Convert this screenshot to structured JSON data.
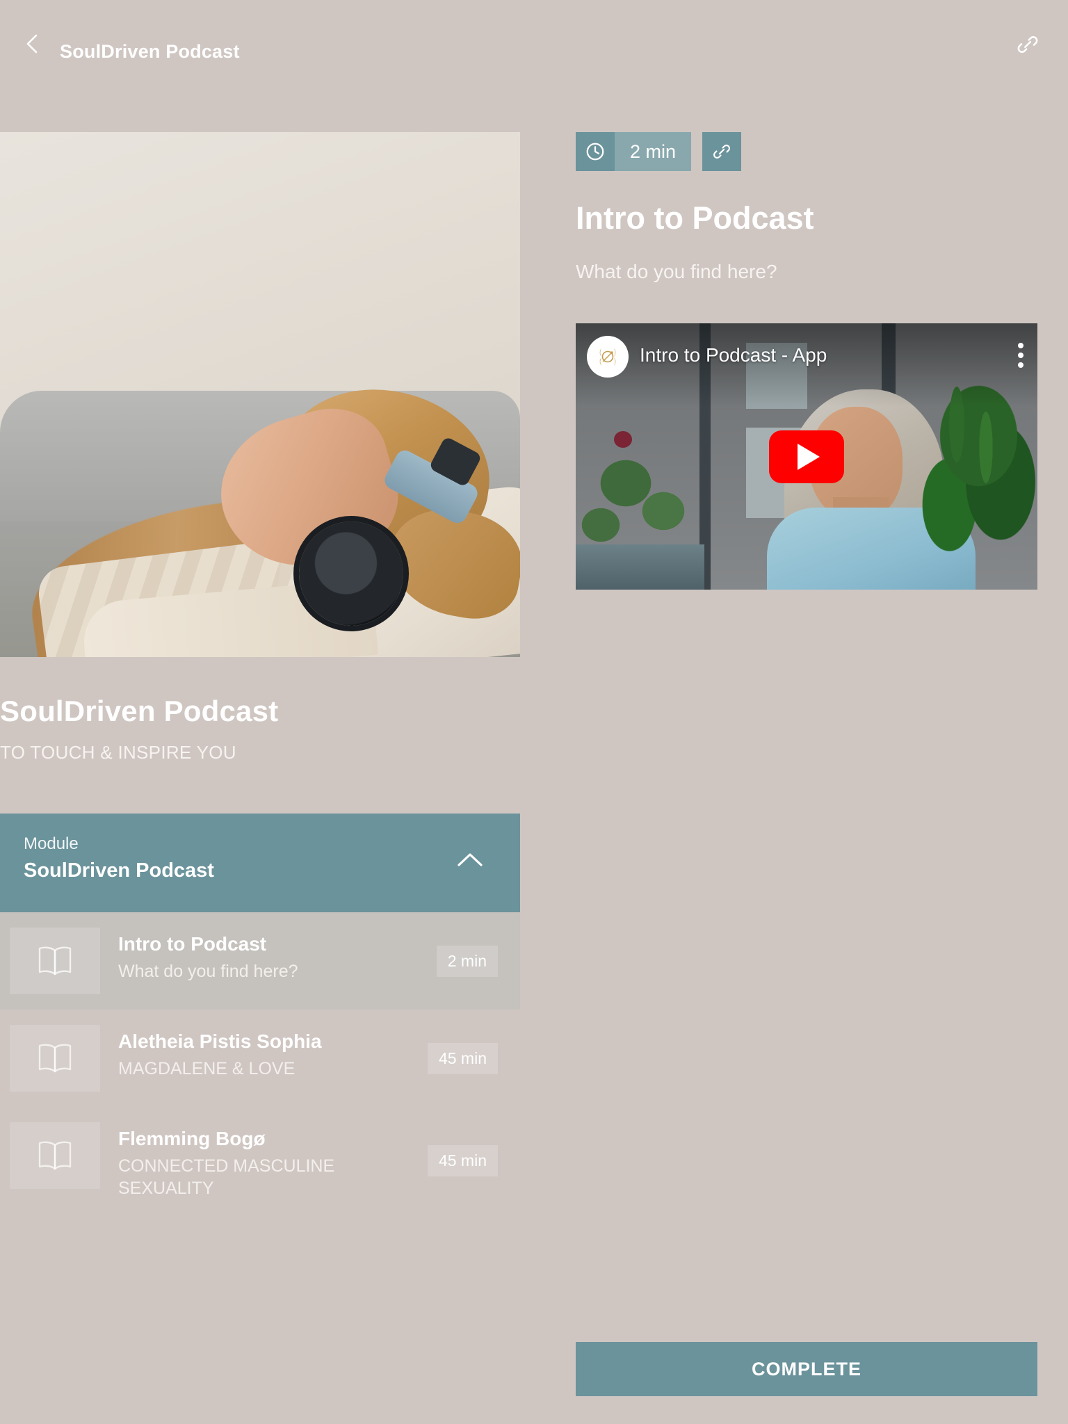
{
  "topbar": {
    "back_icon": "chevron-left-icon",
    "title": "SoulDriven Podcast",
    "share_icon": "link-icon"
  },
  "course": {
    "hero_image_alt": "woman-relaxing-with-headphones",
    "title": "SoulDriven Podcast",
    "subtitle": "TO TOUCH & INSPIRE YOU"
  },
  "module": {
    "kicker": "Module",
    "title": "SoulDriven Podcast",
    "collapse_icon": "chevron-up-icon"
  },
  "lessons": [
    {
      "icon": "open-book-icon",
      "title": "Intro to Podcast",
      "subtitle": "What do you find here?",
      "duration": "2 min",
      "active": true
    },
    {
      "icon": "open-book-icon",
      "title": "Aletheia Pistis Sophia",
      "subtitle": "MAGDALENE & LOVE",
      "duration": "45 min",
      "active": false
    },
    {
      "icon": "open-book-icon",
      "title": "Flemming Bogø",
      "subtitle": "CONNECTED MASCULINE SEXUALITY",
      "duration": "45 min",
      "active": false
    }
  ],
  "lesson_detail": {
    "clock_icon": "clock-icon",
    "duration": "2 min",
    "link_icon": "link-icon",
    "title": "Intro to Podcast",
    "subtitle": "What do you find here?",
    "video": {
      "channel_avatar": "triple-moon-logo-icon",
      "title": "Intro to Podcast - App",
      "menu_icon": "kebab-menu-icon",
      "play_icon": "youtube-play-icon"
    }
  },
  "footer": {
    "complete_label": "COMPLETE"
  },
  "colors": {
    "background": "#cfc6c2",
    "accent_teal": "#6b939b",
    "accent_teal_light": "#88a8ad",
    "active_row": "#c5c1bd",
    "text_white": "#ffffff",
    "youtube_red": "#ff0000"
  }
}
